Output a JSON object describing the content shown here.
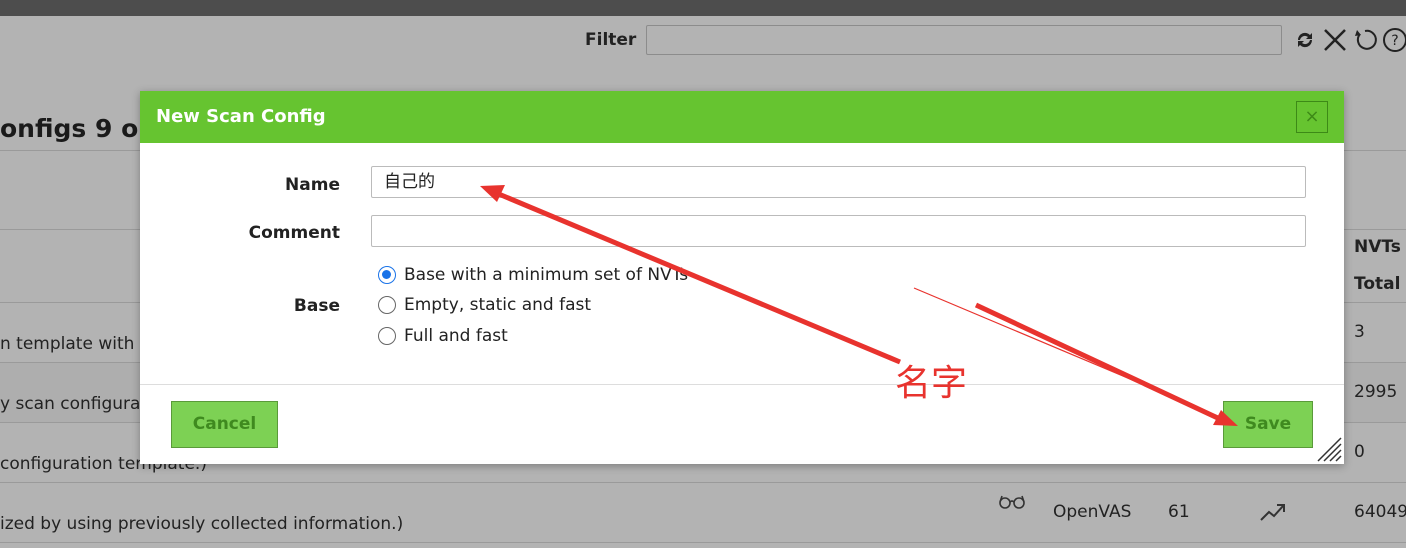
{
  "filter": {
    "label": "Filter",
    "value": ""
  },
  "page": {
    "title": "onfigs 9 o"
  },
  "table": {
    "headers": {
      "nvts": "NVTs",
      "total": "Total"
    },
    "rows": [
      {
        "desc": "n template with",
        "total": "3"
      },
      {
        "desc": "y scan configura",
        "total": "2995"
      },
      {
        "desc": "configuration template.)",
        "total": "0"
      },
      {
        "desc": "ized by using previously collected information.)",
        "scanner": "OpenVAS",
        "families": "61",
        "total": "64049"
      }
    ]
  },
  "dialog": {
    "title": "New Scan Config",
    "close": "×",
    "name_label": "Name",
    "name_value": "自己的",
    "comment_label": "Comment",
    "comment_value": "",
    "base_label": "Base",
    "base_options": [
      {
        "label": "Base with a minimum set of NVTs",
        "selected": true
      },
      {
        "label": "Empty, static and fast",
        "selected": false
      },
      {
        "label": "Full and fast",
        "selected": false
      }
    ],
    "cancel": "Cancel",
    "save": "Save"
  },
  "annotation": {
    "text": "名字",
    "color": "#e8332e"
  },
  "colors": {
    "header_green": "#66c430",
    "button_green": "#7dd154",
    "radio_blue": "#1a73e8"
  },
  "icons": [
    "refresh-icon",
    "clear-icon",
    "reset-icon",
    "help-icon",
    "glasses-icon",
    "trend-icon",
    "resize-icon"
  ]
}
